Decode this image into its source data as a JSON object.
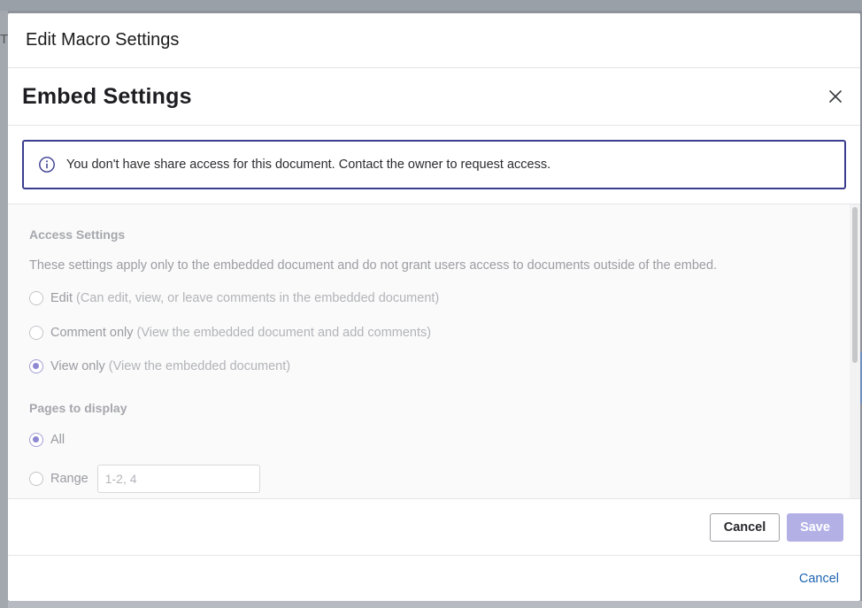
{
  "background": {
    "left_text": "T",
    "overlay_color": "#8e939b"
  },
  "outer_dialog": {
    "title": "Edit Macro Settings",
    "footer_cancel": "Cancel"
  },
  "embed_dialog": {
    "title": "Embed Settings",
    "close_icon": "close-icon",
    "notice": {
      "icon": "info-icon",
      "text": "You don't have share access for this document. Contact the owner to request access."
    },
    "access": {
      "title": "Access Settings",
      "description": "These settings apply only to the embedded document and do not grant users access to documents outside of the embed.",
      "options": [
        {
          "label": "Edit",
          "hint": "(Can edit, view, or leave comments in the embedded document)",
          "checked": false
        },
        {
          "label": "Comment only",
          "hint": "(View the embedded document and add comments)",
          "checked": false
        },
        {
          "label": "View only",
          "hint": "(View the embedded document)",
          "checked": true
        }
      ]
    },
    "pages": {
      "title": "Pages to display",
      "options": [
        {
          "label": "All",
          "checked": true
        },
        {
          "label": "Range",
          "checked": false
        }
      ],
      "range_placeholder": "1-2, 4"
    },
    "footer": {
      "cancel": "Cancel",
      "save": "Save"
    }
  },
  "colors": {
    "accent": "#3b3d8f",
    "save_disabled": "#b3b0e6",
    "link": "#1d64b0"
  }
}
